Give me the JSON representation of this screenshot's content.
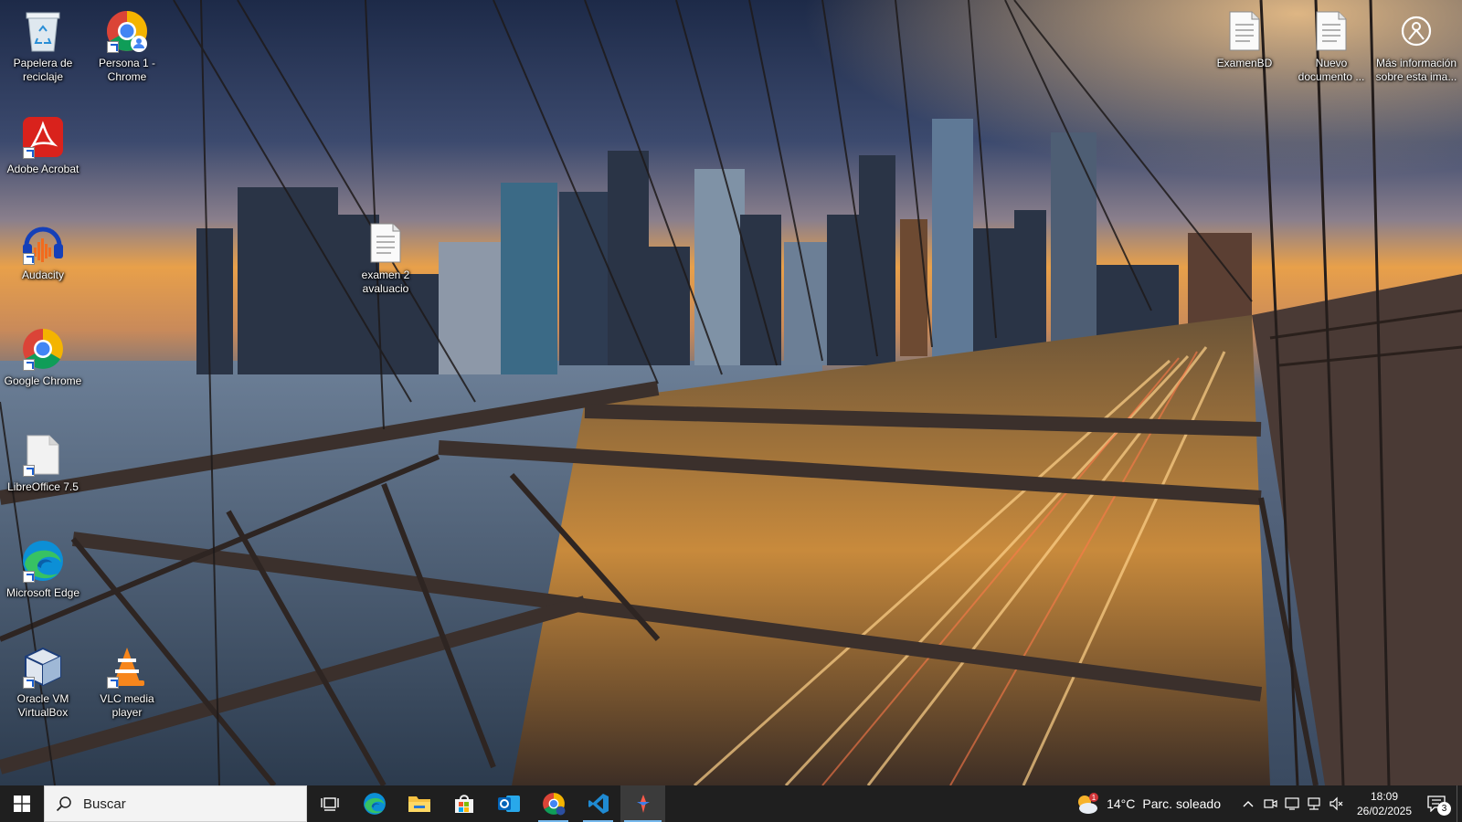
{
  "desktop": {
    "icons": [
      {
        "label": "Papelera de reciclaje",
        "icon": "recycle-bin-icon"
      },
      {
        "label": "Persona 1 - Chrome",
        "icon": "chrome-profile-icon"
      },
      {
        "label": "Adobe Acrobat",
        "icon": "adobe-acrobat-icon"
      },
      {
        "label": "Audacity",
        "icon": "audacity-icon"
      },
      {
        "label": "examen 2 avaluacio",
        "icon": "text-document-icon"
      },
      {
        "label": "Google Chrome",
        "icon": "chrome-icon"
      },
      {
        "label": "LibreOffice 7.5",
        "icon": "libreoffice-icon"
      },
      {
        "label": "Microsoft Edge",
        "icon": "edge-icon"
      },
      {
        "label": "Oracle VM VirtualBox",
        "icon": "virtualbox-icon"
      },
      {
        "label": "VLC media player",
        "icon": "vlc-icon"
      },
      {
        "label": "ExamenBD",
        "icon": "text-document-icon"
      },
      {
        "label": "Nuevo documento ...",
        "icon": "text-document-icon"
      },
      {
        "label": "Más información sobre esta ima...",
        "icon": "spotlight-info-icon"
      }
    ]
  },
  "taskbar": {
    "search_placeholder": "Buscar",
    "apps": [
      {
        "name": "task-view",
        "icon": "task-view-icon"
      },
      {
        "name": "edge",
        "icon": "edge-icon"
      },
      {
        "name": "file-explorer",
        "icon": "folder-icon"
      },
      {
        "name": "microsoft-store",
        "icon": "store-icon"
      },
      {
        "name": "outlook",
        "icon": "outlook-icon"
      },
      {
        "name": "chrome",
        "icon": "chrome-icon"
      },
      {
        "name": "vscode",
        "icon": "vscode-icon"
      },
      {
        "name": "recorder",
        "icon": "recorder-icon"
      }
    ],
    "weather": {
      "badge": "1",
      "temperature": "14°C",
      "description": "Parc. soleado"
    },
    "clock": {
      "time": "18:09",
      "date": "26/02/2025"
    },
    "notifications_count": "3"
  },
  "colors": {
    "taskbar_bg": "#1f1f1f",
    "accent": "#76b9ed",
    "sky_top": "#1d2a48",
    "sky_glow": "#e8a04a"
  }
}
